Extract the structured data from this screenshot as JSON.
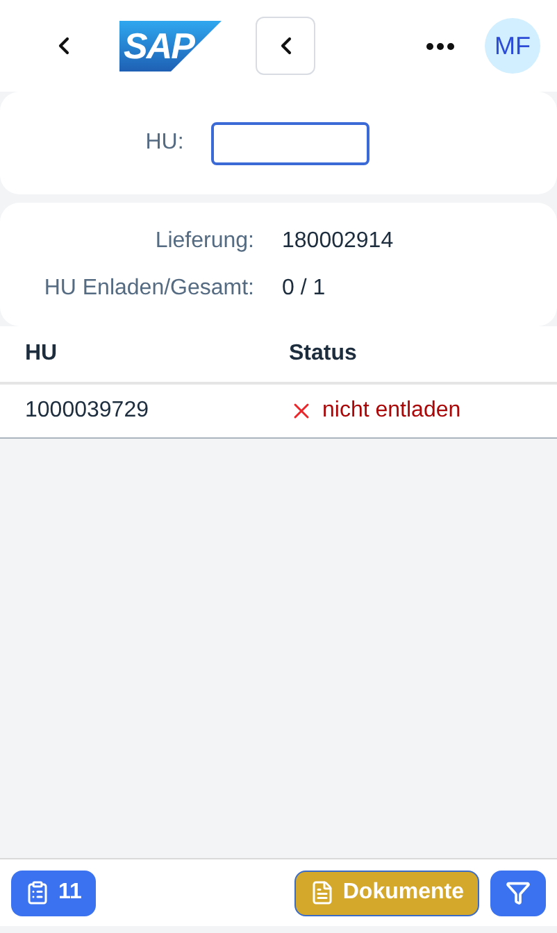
{
  "header": {
    "logo_text": "SAP",
    "avatar": "MF"
  },
  "input": {
    "label": "HU:"
  },
  "info": [
    {
      "label": "Lieferung:",
      "value": "180002914"
    },
    {
      "label": "HU Enladen/Gesamt:",
      "value": "0 / 1"
    }
  ],
  "table": {
    "columns": [
      "HU",
      "Status"
    ],
    "rows": [
      {
        "hu": "1000039729",
        "status": "nicht entladen",
        "unloaded": false
      }
    ]
  },
  "footer": {
    "count": "11",
    "documents": "Dokumente"
  }
}
